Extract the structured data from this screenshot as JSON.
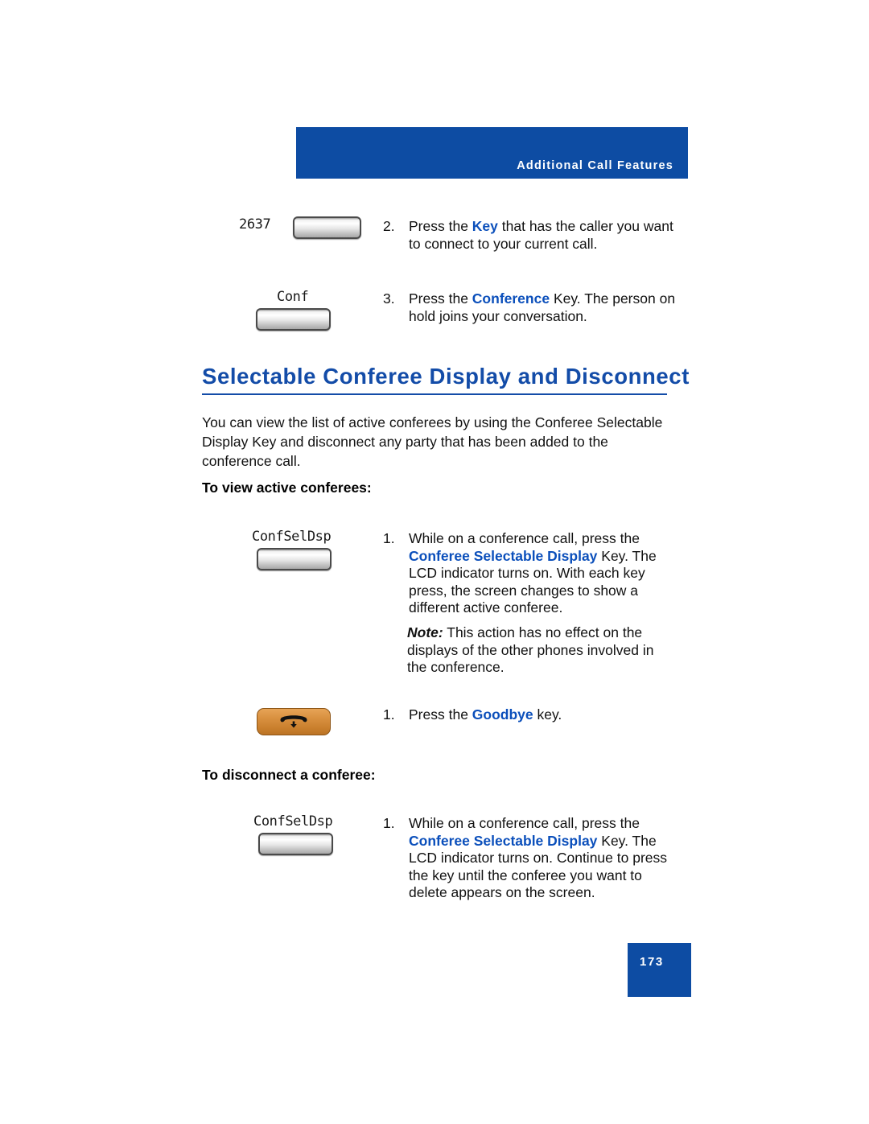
{
  "header": {
    "title": "Additional Call Features",
    "banner_color": "#0d4ca3"
  },
  "steps_top": [
    {
      "number": "2.",
      "key_label": "2637",
      "key_type": "softkey-button",
      "text_parts": [
        {
          "text": "Press the ",
          "style": "normal"
        },
        {
          "text": "Key",
          "style": "bold-blue"
        },
        {
          "text": " that has the caller you want to connect to your current call.",
          "style": "normal"
        }
      ],
      "full_text": "Press the Key that has the caller you want to connect to your current call."
    },
    {
      "number": "3.",
      "key_label": "Conf",
      "key_type": "softkey-button",
      "text_parts": [
        {
          "text": "Press the ",
          "style": "normal"
        },
        {
          "text": "Conference",
          "style": "bold-blue"
        },
        {
          "text": " Key. The person on hold joins your conversation.",
          "style": "normal"
        }
      ],
      "full_text": "Press the Conference Key. The person on hold joins your conversation."
    }
  ],
  "section": {
    "heading": "Selectable Conferee Display and Disconnect",
    "heading_color": "#134ca8",
    "paragraph": "You can view the list of active conferees by using the Conferee Selectable Display Key and disconnect any party that has been added to the conference call."
  },
  "subheading_view": "To view active conferees:",
  "subheading_disconnect": "To disconnect a conferee:",
  "step_view": {
    "number": "1.",
    "key_label": "ConfSelDsp",
    "key_type": "softkey-button",
    "text_lead": "While on a conference call, press the ",
    "text_bold": "Conferee Selectable Display",
    "text_tail": " Key. The LCD indicator turns on. With each key press, the screen changes to show a different active conferee."
  },
  "note": {
    "label": "Note:",
    "text": " This action has no effect on the displays of the other phones involved in the conference."
  },
  "step_goodbye": {
    "number": "1.",
    "key_type": "goodbye-key",
    "key_color": "#d8903f",
    "text_lead": "Press the ",
    "text_bold": "Goodbye",
    "text_tail": " key."
  },
  "step_disconnect": {
    "number": "1.",
    "key_label": "ConfSelDsp",
    "key_type": "softkey-button",
    "text_lead": "While on a conference call, press the ",
    "text_bold": "Conferee Selectable Display",
    "text_tail": " Key. The LCD indicator turns on. Continue to press the key until the conferee you want to delete appears on the screen."
  },
  "footer": {
    "page_number": "173",
    "box_color": "#0d4ca3"
  }
}
